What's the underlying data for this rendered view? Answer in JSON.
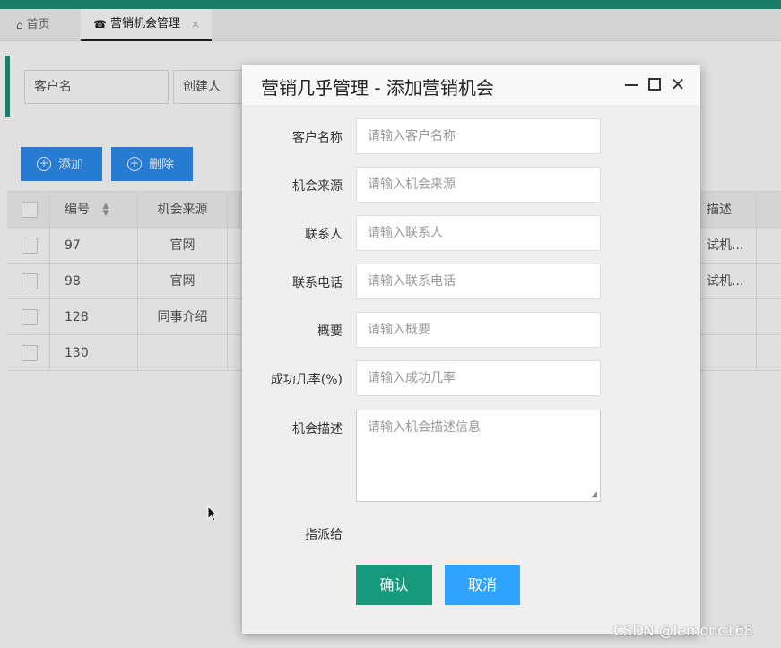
{
  "tabs": {
    "home_label": "首页",
    "active_label": "营销机会管理",
    "close_glyph": "×"
  },
  "search": {
    "customer_name_placeholder": "客户名",
    "creator_placeholder": "创建人"
  },
  "toolbar": {
    "add_label": "添加",
    "delete_label": "删除"
  },
  "table": {
    "headers": {
      "id": "编号",
      "source": "机会来源",
      "description": "描述"
    },
    "rows": [
      {
        "id": "97",
        "source": "官网",
        "description": "试机..."
      },
      {
        "id": "98",
        "source": "官网",
        "description": "试机..."
      },
      {
        "id": "128",
        "source": "同事介绍",
        "description": ""
      },
      {
        "id": "130",
        "source": "",
        "description": ""
      }
    ]
  },
  "modal": {
    "title": "营销几乎管理 - 添加营销机会",
    "fields": {
      "customer_name": {
        "label": "客户名称",
        "placeholder": "请输入客户名称"
      },
      "source": {
        "label": "机会来源",
        "placeholder": "请输入机会来源"
      },
      "contact": {
        "label": "联系人",
        "placeholder": "请输入联系人"
      },
      "phone": {
        "label": "联系电话",
        "placeholder": "请输入联系电话"
      },
      "summary": {
        "label": "概要",
        "placeholder": "请输入概要"
      },
      "rate": {
        "label": "成功几率(%)",
        "placeholder": "请输入成功几率"
      },
      "description": {
        "label": "机会描述",
        "placeholder": "请输入机会描述信息"
      },
      "assign": {
        "label": "指派给"
      }
    },
    "confirm_label": "确认",
    "cancel_label": "取消"
  },
  "watermark": "CSDN @lemonc168",
  "colors": {
    "accent_green": "#1f8f73",
    "primary_blue": "#2d8cf0",
    "confirm_green": "#179a7c",
    "cancel_blue": "#2fa3ff"
  }
}
